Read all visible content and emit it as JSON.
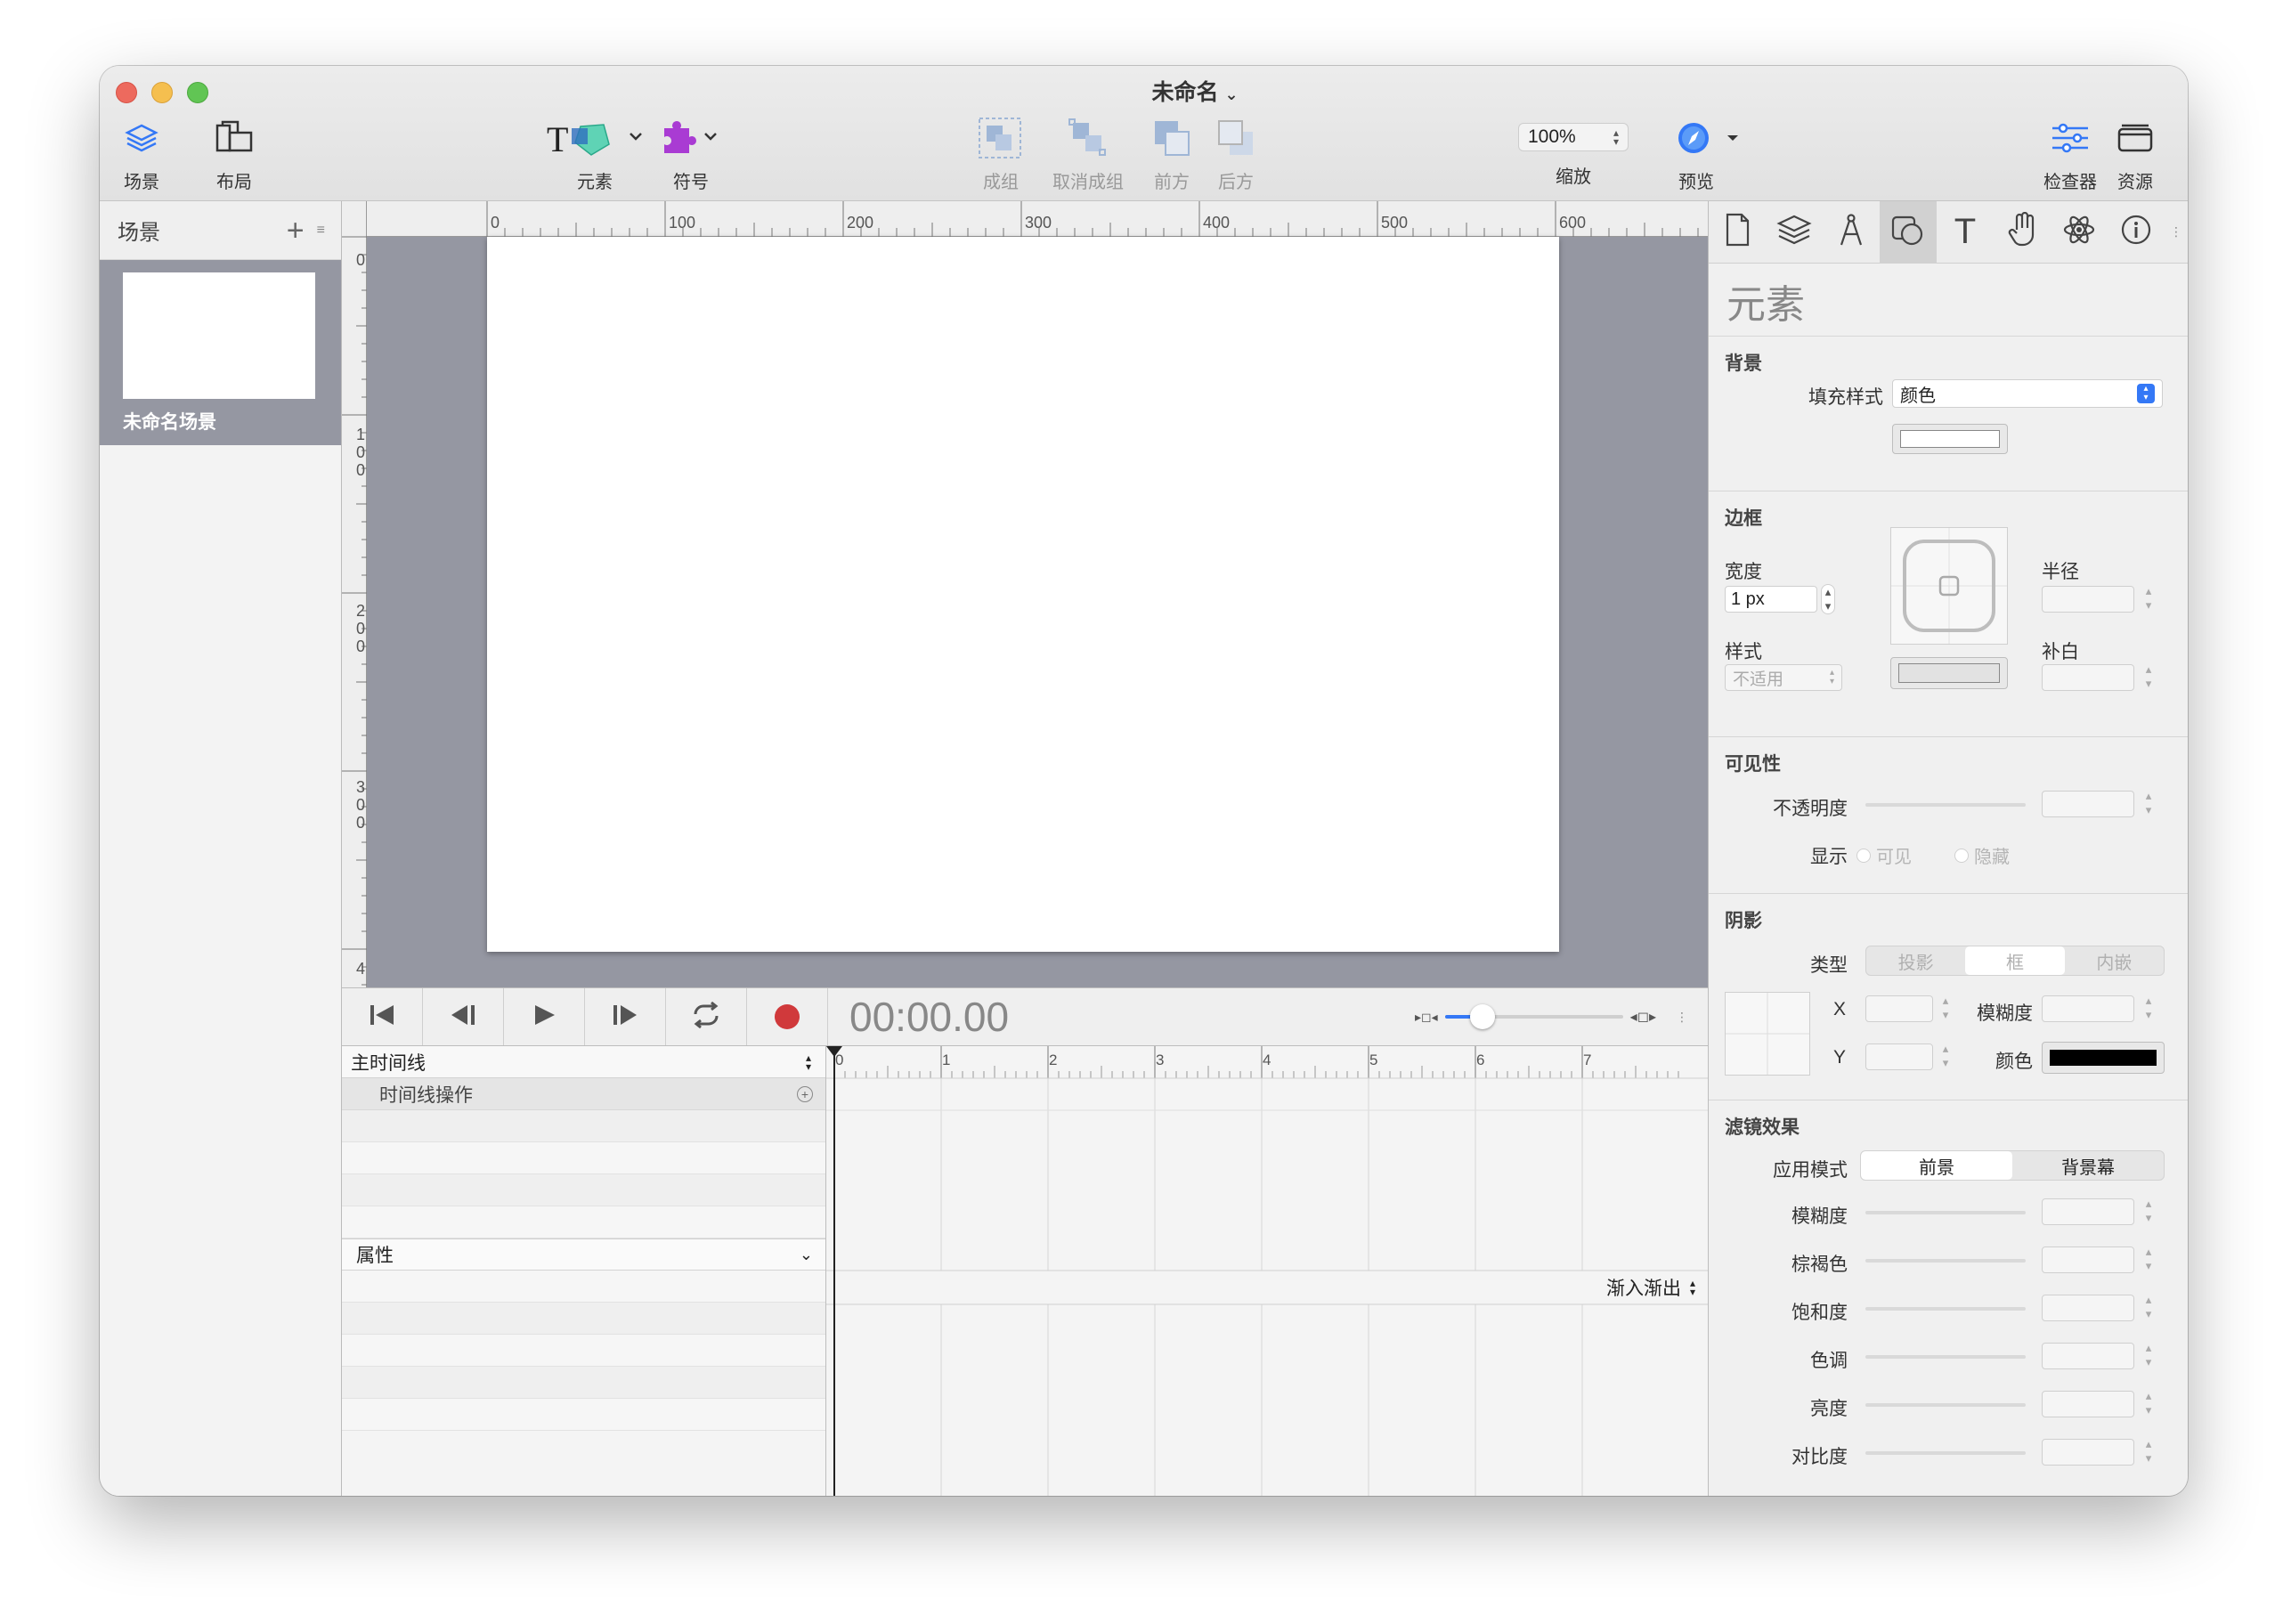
{
  "window": {
    "title": "未命名"
  },
  "toolbar": {
    "scene": "场景",
    "layout": "布局",
    "element": "元素",
    "symbol": "符号",
    "group": "成组",
    "ungroup": "取消成组",
    "front": "前方",
    "back": "后方",
    "zoom_value": "100%",
    "zoom": "缩放",
    "preview": "预览",
    "inspector": "检查器",
    "resources": "资源"
  },
  "scenes": {
    "header": "场景",
    "items": [
      {
        "name": "未命名场景"
      }
    ]
  },
  "ruler": {
    "h": [
      "0",
      "100",
      "200",
      "300",
      "400",
      "500",
      "600"
    ],
    "v": [
      "0",
      "1\n0\n0",
      "2\n0\n0",
      "3\n0\n0",
      "4"
    ]
  },
  "timeline": {
    "time": "00:00.00",
    "main": "主时间线",
    "actions": "时间线操作",
    "properties": "属性",
    "easing": "渐入渐出",
    "ticks": [
      "0",
      "1",
      "2",
      "3",
      "4",
      "5",
      "6",
      "7"
    ]
  },
  "inspector": {
    "title": "元素",
    "background": {
      "header": "背景",
      "fill_label": "填充样式",
      "fill_value": "颜色"
    },
    "border": {
      "header": "边框",
      "width_label": "宽度",
      "width_value": "1 px",
      "style_label": "样式",
      "style_value": "不适用",
      "radius_label": "半径",
      "padding_label": "补白"
    },
    "visibility": {
      "header": "可见性",
      "opacity_label": "不透明度",
      "display_label": "显示",
      "visible": "可见",
      "hidden": "隐藏"
    },
    "shadow": {
      "header": "阴影",
      "type_label": "类型",
      "types": [
        "投影",
        "框",
        "内嵌"
      ],
      "x": "X",
      "y": "Y",
      "blur": "模糊度",
      "color": "颜色"
    },
    "filters": {
      "header": "滤镜效果",
      "apply_label": "应用模式",
      "modes": [
        "前景",
        "背景幕"
      ],
      "blur": "模糊度",
      "sepia": "棕褐色",
      "saturation": "饱和度",
      "hue": "色调",
      "brightness": "亮度",
      "contrast": "对比度"
    }
  },
  "colors": {
    "accent": "#3478f6",
    "record": "#d0393b",
    "canvas_bg": "#9597a2",
    "shadow_color": "#000000"
  }
}
